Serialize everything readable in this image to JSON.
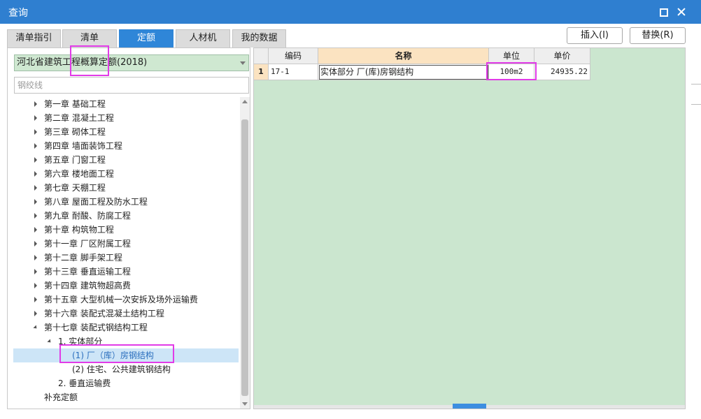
{
  "window": {
    "title": "查询"
  },
  "tabs": [
    "清单指引",
    "清单",
    "定额",
    "人材机",
    "我的数据"
  ],
  "toolbar": {
    "insert_label": "插入(I)",
    "replace_label": "替换(R)"
  },
  "library": {
    "selected": "河北省建筑工程概算定额(2018)"
  },
  "search": {
    "value": "",
    "placeholder": "钢绞线"
  },
  "tree": {
    "chapters": [
      "第一章 基础工程",
      "第二章 混凝土工程",
      "第三章 砌体工程",
      "第四章 墙面装饰工程",
      "第五章 门窗工程",
      "第六章 楼地面工程",
      "第七章 天棚工程",
      "第八章 屋面工程及防水工程",
      "第九章 耐酸、防腐工程",
      "第十章 构筑物工程",
      "第十一章 厂区附属工程",
      "第十二章 脚手架工程",
      "第十三章 垂直运输工程",
      "第十四章 建筑物超高费",
      "第十五章 大型机械一次安拆及场外运输费",
      "第十六章 装配式混凝土结构工程",
      "第十七章 装配式钢结构工程"
    ],
    "sub1": "1. 实体部分",
    "item1": "(1) 厂（库）房钢结构",
    "item2": "(2) 住宅、公共建筑钢结构",
    "sub2": "2. 垂直运输费",
    "extra": "补充定额"
  },
  "grid": {
    "headers": [
      "编码",
      "名称",
      "单位",
      "单价"
    ],
    "rows": [
      {
        "num": "1",
        "code": "17-1",
        "name": "实体部分 厂(库)房钢结构",
        "unit": "100m2",
        "price": "24935.22"
      }
    ]
  }
}
